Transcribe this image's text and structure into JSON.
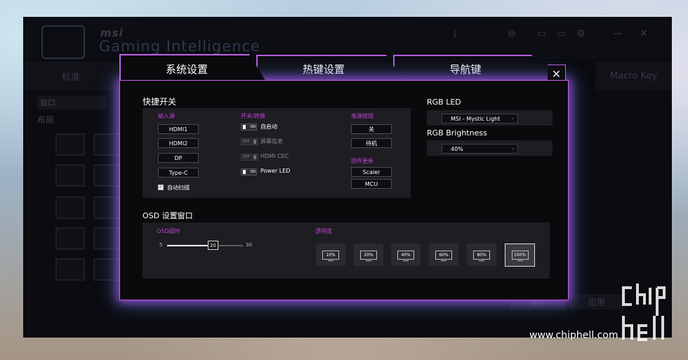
{
  "background_app": {
    "brand": "msi",
    "title": "Gaming Intelligence",
    "tabs": [
      "标准",
      "Macro Key"
    ],
    "sidebar": {
      "section": "窗口",
      "layout_label": "布局"
    },
    "bottom_buttons": [
      "清除",
      "应用"
    ]
  },
  "dialog": {
    "tabs": [
      {
        "label": "系统设置",
        "active": true
      },
      {
        "label": "热键设置",
        "active": false
      },
      {
        "label": "导航键",
        "active": false
      }
    ],
    "close_symbol": "✕",
    "quick_switch": {
      "title": "快捷开关",
      "input_source": {
        "label": "输入源",
        "items": [
          "HDMI1",
          "HDMI2",
          "DP",
          "Type-C"
        ],
        "auto_scan": {
          "label": "自动扫描",
          "checked": true,
          "mark": "✓"
        }
      },
      "switches": {
        "label": "开关/转换",
        "items": [
          {
            "label": "自启动",
            "state": "ON"
          },
          {
            "label": "屏幕信息",
            "state": "OFF"
          },
          {
            "label": "HDMI CEC",
            "state": "OFF"
          },
          {
            "label": "Power LED",
            "state": "ON"
          }
        ]
      },
      "power_button": {
        "label": "电源按钮",
        "items": [
          "关",
          "待机"
        ]
      },
      "firmware_update": {
        "label": "固件更新",
        "items": [
          "Scaler",
          "MCU"
        ]
      }
    },
    "rgb": {
      "led_title": "RGB LED",
      "led_value": "MSI - Mystic Light",
      "brightness_title": "RGB Brightness",
      "brightness_value": "40%"
    },
    "osd": {
      "title": "OSD 设置窗口",
      "timeout": {
        "label": "OSD超时",
        "min": "5",
        "max": "30",
        "value": "20"
      },
      "transparency": {
        "label": "透明度",
        "options": [
          "10%",
          "20%",
          "40%",
          "60%",
          "80%",
          "100%"
        ],
        "selected": "100%"
      }
    }
  },
  "watermark": {
    "url": "www.chiphell.com"
  }
}
